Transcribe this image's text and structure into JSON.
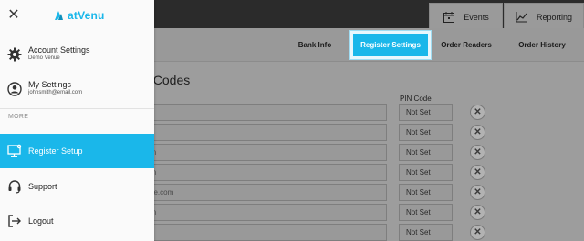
{
  "top_tabs": {
    "events": {
      "label": "Events",
      "icon": "calendar-icon"
    },
    "reporting": {
      "label": "Reporting",
      "icon": "chart-icon"
    }
  },
  "subnav": {
    "bank_info": "Bank Info",
    "register_settings": "Register Settings",
    "order_readers": "Order Readers",
    "order_history": "Order History",
    "active": "Register Settings",
    "active_color": "#1ab7ea"
  },
  "main": {
    "section_title": "I Codes",
    "pin_header": "PIN Code",
    "rows": [
      {
        "email": "m",
        "pin": "Not Set"
      },
      {
        "email": "",
        "pin": "Not Set"
      },
      {
        "email": "om",
        "pin": "Not Set"
      },
      {
        "email": "om",
        "pin": "Not Set"
      },
      {
        "email": "ime.com",
        "pin": "Not Set"
      },
      {
        "email": "om",
        "pin": "Not Set"
      },
      {
        "email": "m",
        "pin": "Not Set"
      }
    ],
    "delete_icon": "close-x-icon"
  },
  "drawer": {
    "close_icon": "close-icon",
    "brand": "atVenu",
    "brand_color": "#1ab7ea",
    "items": {
      "account_settings": {
        "label": "Account Settings",
        "sub": "Demo Venue",
        "icon": "gear-icon"
      },
      "my_settings": {
        "label": "My Settings",
        "sub": "johnsmith@email.com",
        "icon": "user-icon"
      },
      "more": "MORE",
      "register_setup": {
        "label": "Register Setup",
        "icon": "monitor-settings-icon",
        "active": true
      },
      "support": {
        "label": "Support",
        "icon": "headset-icon"
      },
      "logout": {
        "label": "Logout",
        "icon": "logout-icon"
      }
    }
  }
}
